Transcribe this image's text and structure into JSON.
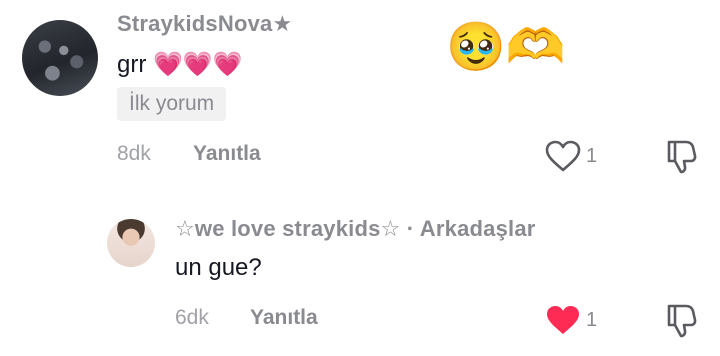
{
  "comments": [
    {
      "username": "StraykidsNova★",
      "text": "grr 💗💗💗",
      "badge": "İlk yorum",
      "time": "8dk",
      "reply_label": "Yanıtla",
      "likes": "1",
      "liked": false
    },
    {
      "username": "☆we love straykids☆",
      "relation": "· Arkadaşlar",
      "text": "un gue?",
      "time": "6dk",
      "reply_label": "Yanıtla",
      "likes": "1",
      "liked": true
    }
  ],
  "reactions": [
    "🥹",
    "🫶"
  ],
  "colors": {
    "like_active": "#fe2c55",
    "muted": "#8a8b91"
  },
  "icons": {
    "like": "heart-icon",
    "dislike": "dislike-icon"
  }
}
